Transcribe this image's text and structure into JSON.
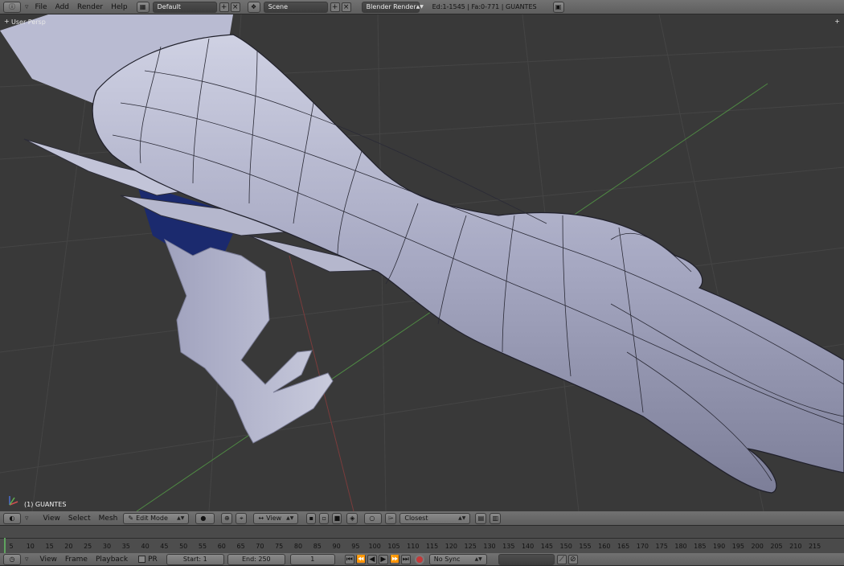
{
  "top_bar": {
    "menus": [
      "File",
      "Add",
      "Render",
      "Help"
    ],
    "screen_layout": "Default",
    "scene": "Scene",
    "render_engine": "Blender Render",
    "stats": "Ed:1-1545 | Fa:0-771 | GUANTES"
  },
  "viewport": {
    "view_label": "User Persp",
    "object_label": "(1) GUANTES",
    "colors": {
      "background": "#393939",
      "grid": "#454545",
      "x_axis": "#b04848",
      "y_axis": "#5a9a4a",
      "mesh": "#a9abc6",
      "cloth": "#1b2a6e"
    }
  },
  "viewport_header": {
    "menus": [
      "View",
      "Select",
      "Mesh"
    ],
    "mode": "Edit Mode",
    "orientation": "View",
    "snap_target": "Closest"
  },
  "timeline": {
    "ticks": [
      "5",
      "10",
      "15",
      "20",
      "25",
      "30",
      "35",
      "40",
      "45",
      "50",
      "55",
      "60",
      "65",
      "70",
      "75",
      "80",
      "85",
      "90",
      "95",
      "100",
      "105",
      "110",
      "115",
      "120",
      "125",
      "130",
      "135",
      "140",
      "145",
      "150",
      "155",
      "160",
      "165",
      "170",
      "175",
      "180",
      "185",
      "190",
      "195",
      "200",
      "205",
      "210",
      "215"
    ],
    "current_frame_value": 1
  },
  "timeline_header": {
    "menus": [
      "View",
      "Frame",
      "Playback"
    ],
    "pr_label": "PR",
    "start": "Start: 1",
    "end": "End: 250",
    "current_frame": "1",
    "sync": "No Sync"
  }
}
